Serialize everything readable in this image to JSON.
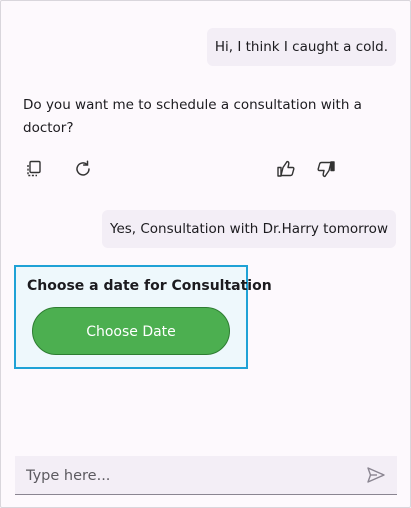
{
  "messages": {
    "user_1": "Hi, I think I caught a cold.",
    "bot_1": "Do you want me to schedule a consultation with a doctor?",
    "user_2": "Yes, Consultation with Dr.Harry tomorrow"
  },
  "actions": {
    "copy_icon": "copy-icon",
    "regenerate_icon": "refresh-icon",
    "like_icon": "thumbs-up-icon",
    "dislike_icon": "thumbs-down-icon"
  },
  "card": {
    "title": "Choose a date for Consultation",
    "button_label": "Choose Date",
    "border_color": "#1fa2d6",
    "button_color": "#4caf50"
  },
  "composer": {
    "placeholder": "Type here...",
    "send_icon": "send-icon"
  }
}
